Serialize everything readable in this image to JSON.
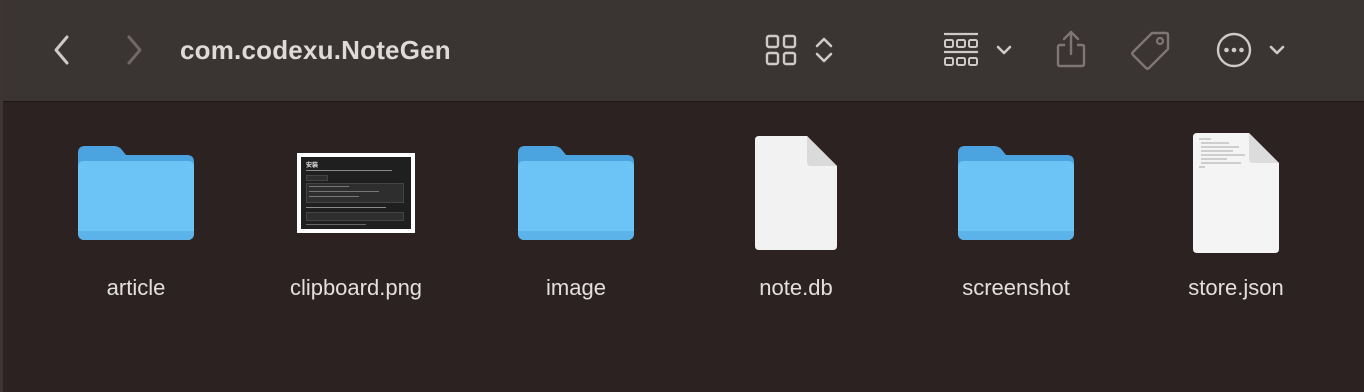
{
  "window": {
    "title": "com.codexu.NoteGen"
  },
  "toolbar": {
    "back_icon": "chevron-left-icon",
    "forward_icon": "chevron-right-icon",
    "view_icon": "icon-view-grid-icon",
    "view_toggle_icon": "up-down-chevron-icon",
    "group_icon": "group-by-icon",
    "group_menu_icon": "chevron-down-icon",
    "share_icon": "share-icon",
    "tag_icon": "tag-icon",
    "more_icon": "ellipsis-circle-icon",
    "more_menu_icon": "chevron-down-icon"
  },
  "files": [
    {
      "name": "article",
      "kind": "folder"
    },
    {
      "name": "clipboard.png",
      "kind": "image",
      "preview_title": "安装"
    },
    {
      "name": "image",
      "kind": "folder"
    },
    {
      "name": "note.db",
      "kind": "document"
    },
    {
      "name": "screenshot",
      "kind": "folder"
    },
    {
      "name": "store.json",
      "kind": "text-document"
    }
  ],
  "colors": {
    "toolbar_bg": "#3a3433",
    "content_bg": "#2b2221",
    "folder_front": "#6cc4f6",
    "folder_back": "#4ba3e0",
    "text": "#e3dfde"
  }
}
